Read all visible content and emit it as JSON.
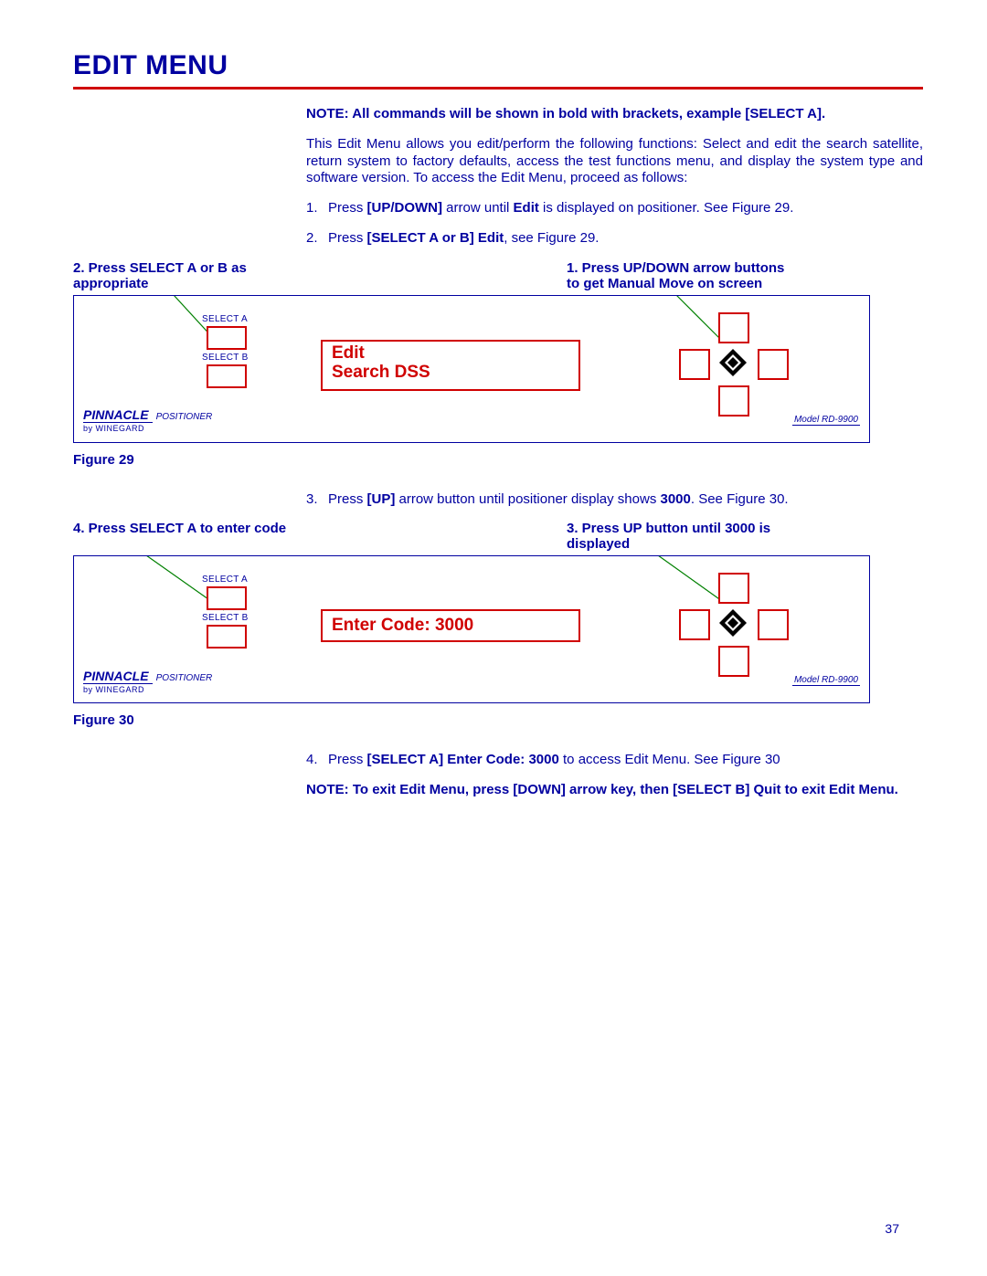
{
  "title": "EDIT MENU",
  "note_line": "NOTE:  All commands will be shown in bold with brackets, example [SELECT A].",
  "intro": "This Edit Menu allows you edit/perform the following functions:  Select and edit the search satellite, return system to factory defaults, access the test functions menu, and display the system type and software version.  To access the Edit Menu, proceed as follows:",
  "steps": {
    "s1a": "1.",
    "s1b_pre": "Press ",
    "s1b_b1": "[UP/DOWN]",
    "s1b_mid": " arrow until ",
    "s1b_b2": "Edit",
    "s1b_post": " is displayed on positioner.  See Figure 29.",
    "s2a": "2.",
    "s2b_pre": "Press ",
    "s2b_b1": "[SELECT A or B] Edit",
    "s2b_post": ", see Figure 29.",
    "s3a": "3.",
    "s3b_pre": "Press ",
    "s3b_b1": "[UP]",
    "s3b_mid": " arrow button until positioner display shows ",
    "s3b_b2": "3000",
    "s3b_post": ".  See Figure 30.",
    "s4a": "4.",
    "s4b_pre": "Press ",
    "s4b_b1": "[SELECT A] Enter Code:  3000",
    "s4b_post": " to access Edit Menu.  See Figure 30"
  },
  "note2": "NOTE:  To exit Edit Menu, press [DOWN] arrow key, then [SELECT B] Quit to exit Edit Menu.",
  "callouts": {
    "fig29_left": "2. Press SELECT A or B as appropriate",
    "fig29_right": "1.  Press UP/DOWN arrow buttons to get Manual Move on screen",
    "fig30_left": "4. Press SELECT A to enter code",
    "fig30_right": "3.   Press UP button until 3000 is displayed"
  },
  "figures": {
    "fig29_caption": "Figure 29",
    "fig30_caption": "Figure 30"
  },
  "device": {
    "select_a": "SELECT A",
    "select_b": "SELECT B",
    "brand1": "PINNACLE",
    "brand2": "POSITIONER",
    "brand3": "by  WINEGARD",
    "model": "Model RD-9900",
    "display29_l1": "Edit",
    "display29_l2": "Search    DSS",
    "display30": "Enter Code:  3000"
  },
  "page_number": "37"
}
